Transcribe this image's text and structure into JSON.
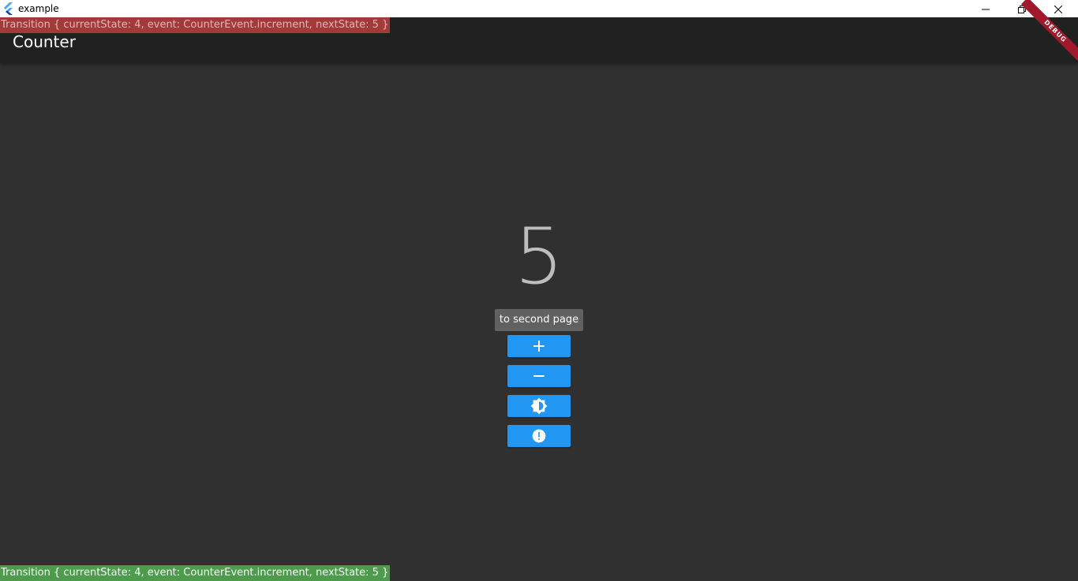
{
  "window": {
    "title": "example",
    "controls": [
      "minimize-icon",
      "restore-icon",
      "close-icon"
    ]
  },
  "appbar": {
    "title": "Counter"
  },
  "debug_ribbon": {
    "label": "DEBUG",
    "color": "#a0182a"
  },
  "transition_top": {
    "text": "Transition { currentState: 4, event: CounterEvent.increment, nextState: 5 }",
    "color": "#a23a3a"
  },
  "transition_bottom": {
    "text": "Transition { currentState: 4, event: CounterEvent.increment, nextState: 5 }",
    "color": "#4e9b4e"
  },
  "counter": {
    "value": "5"
  },
  "tooltip": {
    "text": "to second page"
  },
  "buttons": [
    {
      "icon": "add-icon"
    },
    {
      "icon": "remove-icon"
    },
    {
      "icon": "brightness-icon"
    },
    {
      "icon": "error-icon"
    }
  ],
  "colors": {
    "background": "#303030",
    "appbar": "#212121",
    "accent": "#2196f3"
  }
}
